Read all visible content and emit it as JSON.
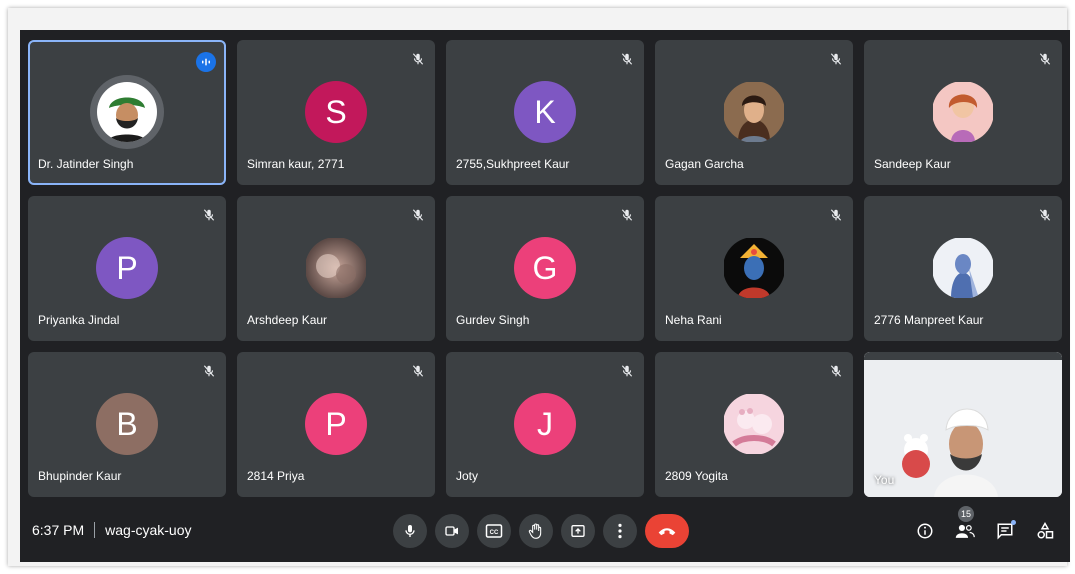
{
  "participants": [
    {
      "name": "Dr. Jatinder Singh",
      "letter": "",
      "color": "",
      "photo": "turban-man",
      "speaking": true
    },
    {
      "name": "Simran kaur, 2771",
      "letter": "S",
      "color": "#c2185b"
    },
    {
      "name": "2755,Sukhpreet Kaur",
      "letter": "K",
      "color": "#7e57c2"
    },
    {
      "name": "Gagan Garcha",
      "letter": "",
      "color": "",
      "photo": "woman"
    },
    {
      "name": "Sandeep Kaur",
      "letter": "",
      "color": "",
      "photo": "doll"
    },
    {
      "name": "Priyanka Jindal",
      "letter": "P",
      "color": "#7e57c2"
    },
    {
      "name": "Arshdeep Kaur",
      "letter": "",
      "color": "",
      "photo": "blurred"
    },
    {
      "name": "Gurdev Singh",
      "letter": "G",
      "color": "#ec407a"
    },
    {
      "name": "Neha Rani",
      "letter": "",
      "color": "",
      "photo": "deity"
    },
    {
      "name": "2776 Manpreet Kaur",
      "letter": "",
      "color": "",
      "photo": "veiled"
    },
    {
      "name": "Bhupinder Kaur",
      "letter": "B",
      "color": "#8d6e63"
    },
    {
      "name": "2814 Priya",
      "letter": "P",
      "color": "#ec407a"
    },
    {
      "name": "Joty",
      "letter": "J",
      "color": "#ec407a"
    },
    {
      "name": "2809 Yogita",
      "letter": "",
      "color": "",
      "photo": "teddy"
    }
  ],
  "self_tile": {
    "label": "You"
  },
  "bottom_bar": {
    "time": "6:37 PM",
    "meeting_code": "wag-cyak-uoy",
    "people_count": "15"
  },
  "icons": {
    "mute": "mic-off-icon",
    "speaking": "audio-wave-icon",
    "controls": [
      "mic-icon",
      "camera-icon",
      "captions-icon",
      "raise-hand-icon",
      "present-icon",
      "more-icon",
      "end-call-icon"
    ],
    "right": [
      "info-icon",
      "people-icon",
      "chat-icon",
      "activities-icon"
    ]
  },
  "colors": {
    "background": "#202124",
    "tile": "#3c4043",
    "end_call": "#ea4335",
    "highlight": "#8ab4f8"
  }
}
